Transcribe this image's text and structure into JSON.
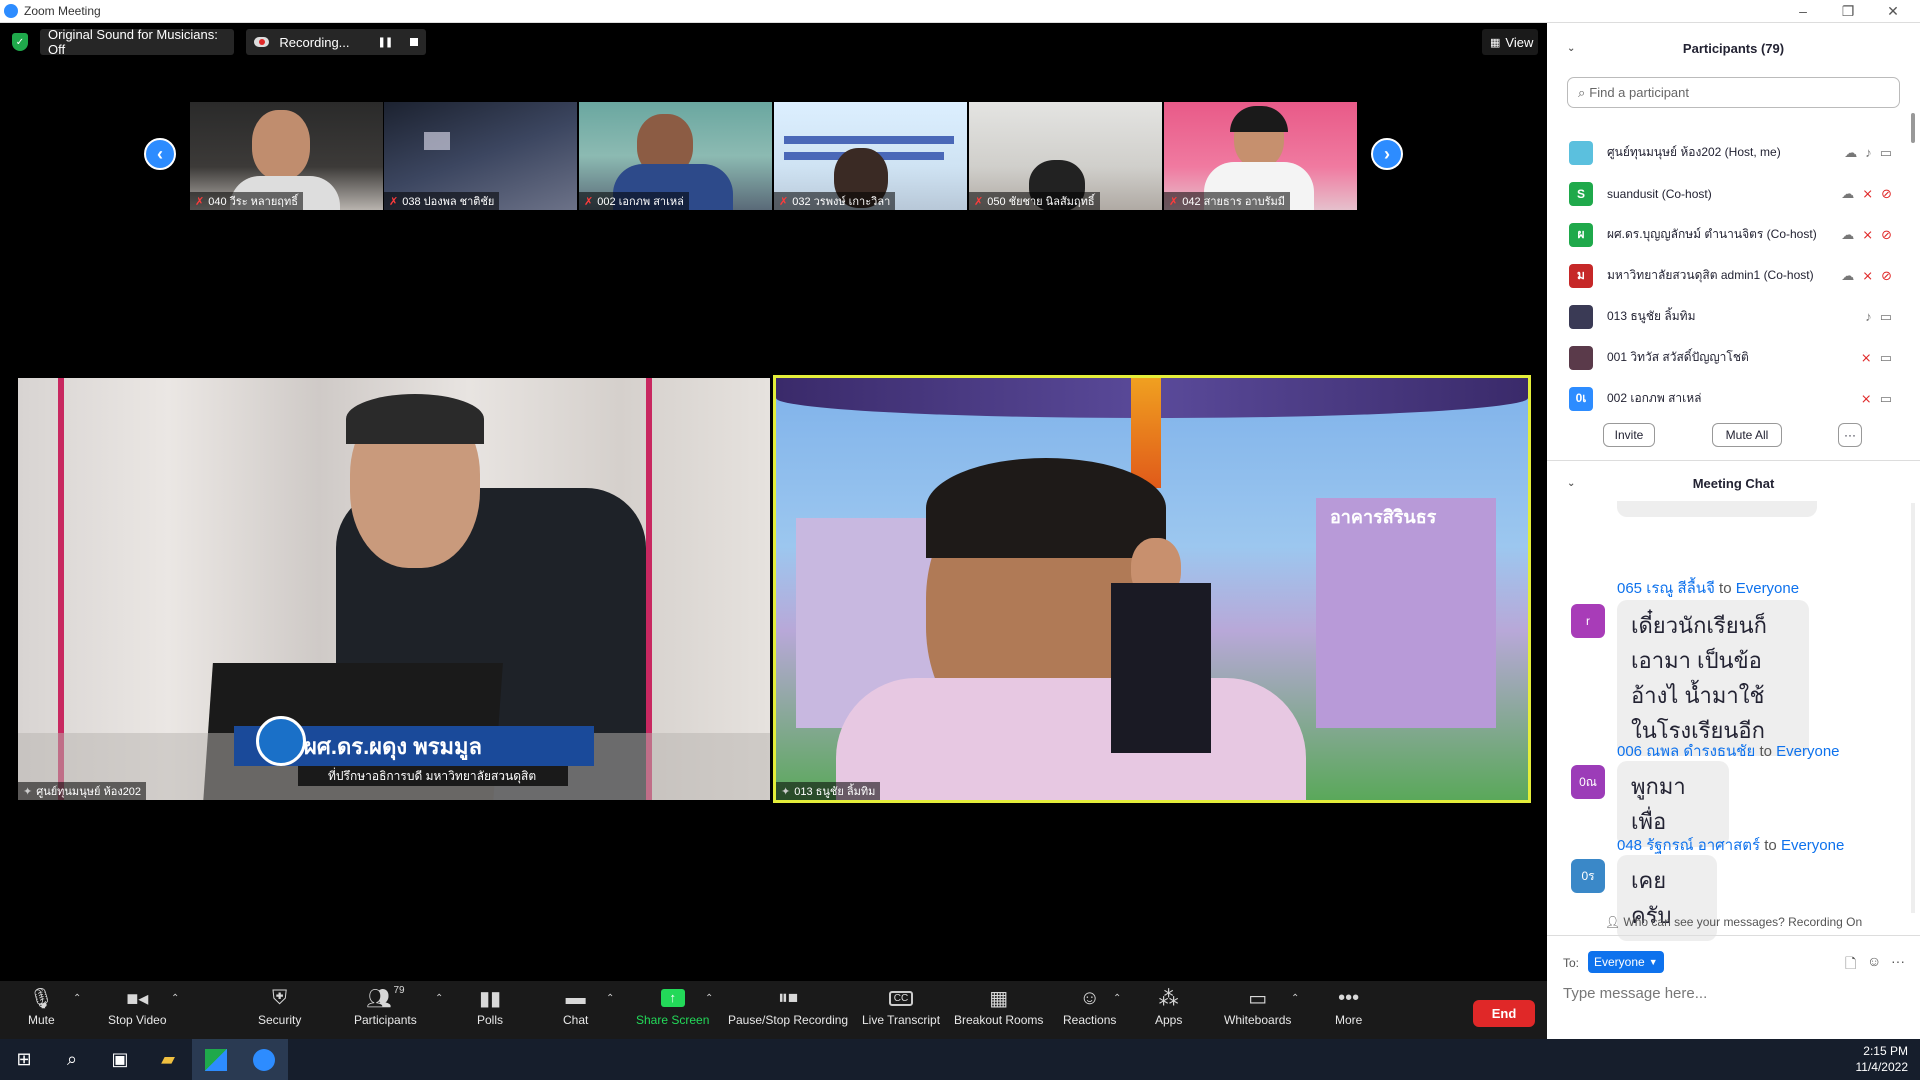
{
  "window": {
    "title": "Zoom Meeting"
  },
  "topbar": {
    "original_sound": "Original Sound for Musicians: Off",
    "recording": "Recording...",
    "view": "View"
  },
  "thumbnails": [
    {
      "name": "040 วีระ หลายฤทธิ์"
    },
    {
      "name": "038 ปองพล ชาติชัย"
    },
    {
      "name": "002 เอกภพ สาเหล่"
    },
    {
      "name": "032 วรพงษ์ เกาะวิลา"
    },
    {
      "name": "050 ชัยชาย นิลสัมฤทธิ์"
    },
    {
      "name": "042 สายธาร อาบรัมมี"
    }
  ],
  "main_videos": {
    "left_name": "ศูนย์ทุนมนุษย์ ห้อง202",
    "lower_third_name": "ผศ.ดร.ผดุง พรมมูล",
    "lower_third_role": "ที่ปรึกษาอธิการบดี มหาวิทยาลัยสวนดุสิต",
    "right_name": "013 ธนูชัย ลิ้มทิม",
    "banner_text": "อาคารสิรินธร"
  },
  "toolbar": {
    "mute": "Mute",
    "stop_video": "Stop Video",
    "security": "Security",
    "participants": "Participants",
    "participants_count": "79",
    "polls": "Polls",
    "chat": "Chat",
    "share_screen": "Share Screen",
    "pause_recording": "Pause/Stop Recording",
    "live_transcript": "Live Transcript",
    "breakout": "Breakout Rooms",
    "reactions": "Reactions",
    "apps": "Apps",
    "whiteboards": "Whiteboards",
    "more": "More",
    "end": "End"
  },
  "participants_panel": {
    "title": "Participants (79)",
    "search_placeholder": "Find a participant",
    "items": [
      {
        "name": "ศูนย์ทุนมนุษย์ ห้อง202 (Host, me)",
        "avatar": "",
        "color": "#5bc0de"
      },
      {
        "name": "suandusit (Co-host)",
        "avatar": "S",
        "color": "#1fa94b"
      },
      {
        "name": "ผศ.ดร.บุญญลักษม์ ตำนานจิตร (Co-host)",
        "avatar": "ผ",
        "color": "#1fa94b"
      },
      {
        "name": "มหาวิทยาลัยสวนดุสิต admin1 (Co-host)",
        "avatar": "ม",
        "color": "#c62828"
      },
      {
        "name": "013 ธนูชัย ลิ้มทิม",
        "avatar": "",
        "color": "#3a3a55"
      },
      {
        "name": "001 วิทวัส สวัสดิ์ปัญญาโชติ",
        "avatar": "",
        "color": "#5a3a4a"
      },
      {
        "name": "002 เอกภพ สาเหล่",
        "avatar": "0เ",
        "color": "#2d8cff"
      }
    ],
    "invite": "Invite",
    "mute_all": "Mute All"
  },
  "chat_panel": {
    "title": "Meeting Chat",
    "messages": [
      {
        "sender": "065 เรณู สีลื้นจี",
        "to": "to",
        "target": "Everyone",
        "avatar": "r",
        "color": "#a83cb8",
        "text": "เดี๋ยวนักเรียนก็เอามา เป็นข้ออ้างไ น้ำมาใช้ ในโรงเรียนอีก"
      },
      {
        "sender": "006 ณพล ดำรงธนชัย",
        "to": "to",
        "target": "Everyone",
        "avatar": "0ณ",
        "color": "#9c3cb8",
        "text": "พูกมาเพื่อ"
      },
      {
        "sender": "048 รัฐกรณ์ อาศาสตร์",
        "to": "to",
        "target": "Everyone",
        "avatar": "0ร",
        "color": "#3a88c8",
        "text": "เคยครับ"
      }
    ],
    "privacy": "Who can see your messages? Recording On",
    "to_label": "To:",
    "to_value": "Everyone",
    "input_placeholder": "Type message here..."
  },
  "taskbar": {
    "time": "2:15 PM",
    "date": "11/4/2022"
  }
}
